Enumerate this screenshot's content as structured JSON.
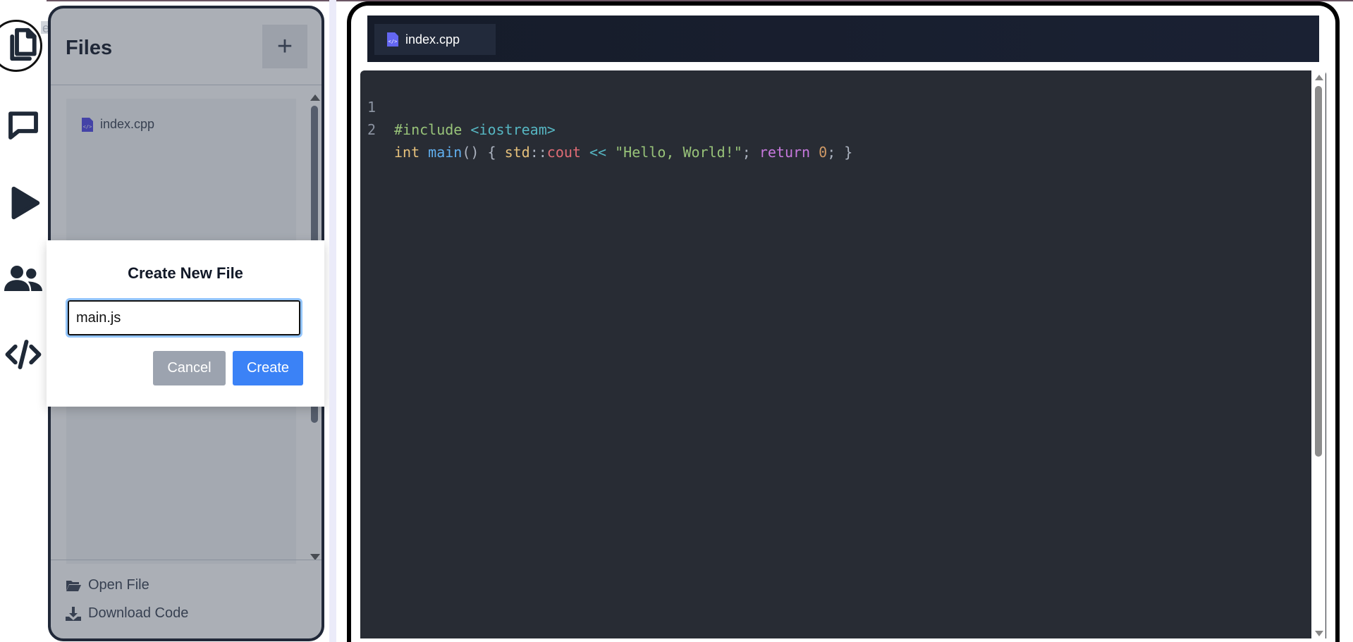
{
  "activity_bar": {
    "items": [
      {
        "icon": "files-icon"
      },
      {
        "icon": "chat-icon"
      },
      {
        "icon": "run-icon"
      },
      {
        "icon": "users-icon"
      },
      {
        "icon": "code-icon"
      }
    ],
    "files_tooltip_fragment": "es"
  },
  "sidebar": {
    "title": "Files",
    "add_label": "+",
    "files": [
      {
        "name": "index.cpp",
        "icon": "code-file-icon"
      }
    ],
    "footer": {
      "open_file": "Open File",
      "download_code": "Download Code"
    }
  },
  "modal": {
    "title": "Create New File",
    "input_value": "main.js",
    "cancel_label": "Cancel",
    "create_label": "Create"
  },
  "editor": {
    "tab_label": "index.cpp",
    "lines": [
      {
        "num": "1",
        "tokens": {
          "t1": "#include ",
          "t2": "<iostream>"
        }
      },
      {
        "num": "2",
        "tokens": {
          "t1": "int ",
          "t2": "main",
          "t3": "() { ",
          "t4": "std",
          "t5": "::",
          "t6": "cout",
          "t7": " << ",
          "t8": "\"Hello, World!\"",
          "t9": "; ",
          "t10": "return ",
          "t11": "0",
          "t12": "; }"
        }
      }
    ]
  },
  "colors": {
    "accent": "#3b82f6",
    "cancel_button": "#9ca3af",
    "editor_background": "#282c34",
    "tab_bar_background": "#161c2a"
  }
}
